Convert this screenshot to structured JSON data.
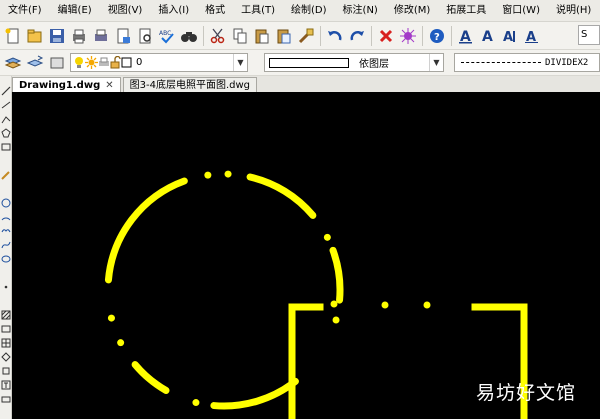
{
  "menu": [
    "文件(F)",
    "编辑(E)",
    "视图(V)",
    "插入(I)",
    "格式",
    "工具(T)",
    "绘制(D)",
    "标注(N)",
    "修改(M)",
    "拓展工具",
    "窗口(W)",
    "说明(H)"
  ],
  "toolbar": {
    "text_style_value": "S"
  },
  "layer": {
    "current_name": "0"
  },
  "color": {
    "current_name": "依图层"
  },
  "linetype": {
    "current_name": "DIVIDEX2"
  },
  "tabs": [
    {
      "label": "Drawing1.dwg",
      "active": true,
      "close": "✕"
    },
    {
      "label": "图3-4底层电照平面图.dwg",
      "active": false
    }
  ],
  "watermark": "易坊好文馆",
  "colors": {
    "drawing_line": "#ffff00",
    "canvas_bg": "#000000"
  }
}
